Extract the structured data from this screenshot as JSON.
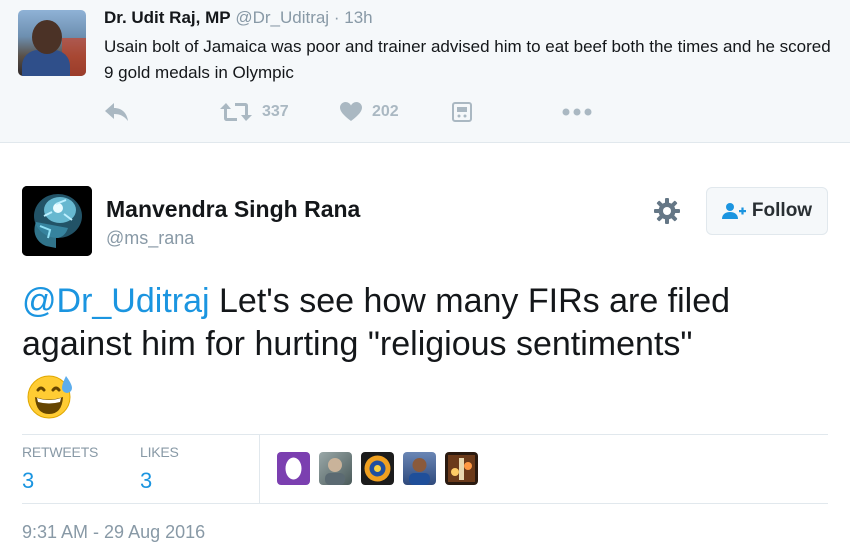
{
  "parent_tweet": {
    "author_name": "Dr. Udit Raj, MP",
    "author_handle": "@Dr_Uditraj",
    "time": "13h",
    "text": "Usain bolt of Jamaica was poor and trainer advised him  to eat beef both the times and he scored 9 gold medals in Olympic",
    "actions": {
      "reply_icon": "reply-icon",
      "retweet_icon": "retweet-icon",
      "retweet_count": "337",
      "like_icon": "heart-icon",
      "like_count": "202",
      "photo_icon": "photo-icon",
      "more_icon": "more-dots-icon"
    }
  },
  "main_tweet": {
    "author_name": "Manvendra Singh Rana",
    "author_handle": "@ms_rana",
    "settings_icon": "gear-icon",
    "follow_label": "Follow",
    "follow_icon": "add-user-icon",
    "mention": "@Dr_Uditraj",
    "text_rest": " Let's see how many FIRs are filed against him for hurting \"religious sentiments\"",
    "emoji": "grinning-sweat-emoji",
    "stats": {
      "retweets_label": "RETWEETS",
      "retweets_value": "3",
      "likes_label": "LIKES",
      "likes_value": "3"
    },
    "timestamp": "9:31 AM - 29 Aug 2016"
  },
  "colors": {
    "link": "#1b95e0",
    "muted": "#8899a6",
    "action_icon": "#aab8c2",
    "panel_bg": "#f5f8fa"
  }
}
